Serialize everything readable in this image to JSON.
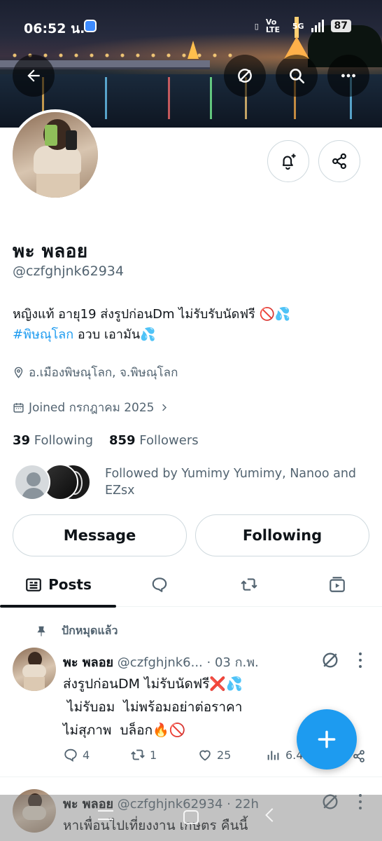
{
  "status_bar": {
    "time": "06:52 น.",
    "network_left": "Vo LTE",
    "network_right": "5G",
    "battery": "87"
  },
  "profile": {
    "display_name": "พะ พลอย",
    "handle": "@czfghjnk62934",
    "bio_line1": "หญิงแท้ อายุ19 ส่งรูปก่อนDm ไม่รับรับนัดฟรี 🚫💦",
    "bio_hashtag": "#พิษณุโลก",
    "bio_line2_rest": " อวบ เอามัน💦",
    "location": "อ.เมืองพิษณุโลก, จ.พิษณุโลก",
    "joined": "Joined กรกฎาคม 2025",
    "following_count": "39",
    "following_label": "Following",
    "followers_count": "859",
    "followers_label": "Followers",
    "followed_by": "Followed by Yumimy Yumimy, Nanoo and EZsx"
  },
  "buttons": {
    "message": "Message",
    "following": "Following"
  },
  "tabs": {
    "posts": "Posts"
  },
  "pinned_label": "ปักหมุดแล้ว",
  "posts": [
    {
      "name": "พะ พลอย",
      "handle": "@czfghjnk6...",
      "time": "· 03 ก.พ.",
      "line1": "ส่งรูปก่อนDM ไม่รับนัดฟรี❌💦",
      "line2": " ไม่รับอม  ไม่พร้อมอย่าต่อราคา",
      "line3": "ไม่สุภาพ  บล็อก🔥🚫",
      "replies": "4",
      "reposts": "1",
      "likes": "25",
      "views": "6.4"
    },
    {
      "name": "พะ พลอย",
      "handle": "@czfghjnk62934",
      "time": "· 22h",
      "line1": "หาเพื่อนไปเที่ยงงาน เกษตร คืนนี้"
    }
  ],
  "colors": {
    "accent": "#1d9bf0",
    "text": "#0f1419",
    "muted": "#536471",
    "border": "#cfd9de"
  },
  "icons": [
    "back-arrow-icon",
    "grok-icon",
    "search-icon",
    "more-icon",
    "bell-plus-icon",
    "share-icon",
    "location-pin-icon",
    "calendar-icon",
    "chevron-right-icon",
    "posts-icon",
    "reply-bubble-icon",
    "retweet-icon",
    "media-icon",
    "pin-icon",
    "views-icon",
    "plus-icon"
  ]
}
